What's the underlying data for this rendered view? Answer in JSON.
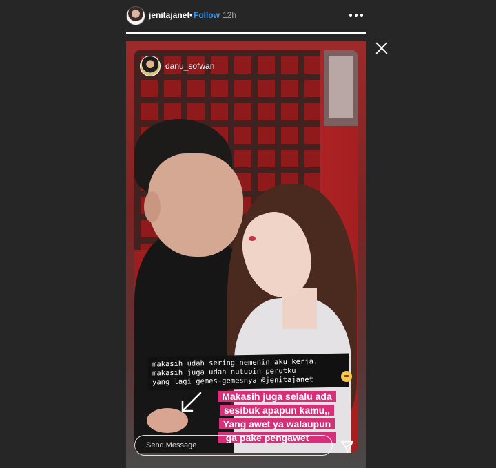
{
  "header": {
    "username": "jenitajanet",
    "separator": "•",
    "follow_label": "Follow",
    "time": "12h"
  },
  "story": {
    "progress_fraction": 1.0,
    "reposted_from": "danu_sofwan",
    "caption_lines": [
      "makasih udah sering nemenin aku kerja.",
      "makasih juga udah nutupin perutku",
      "yang lagi gemes-gemesnya @jenitajanet"
    ],
    "reply_lines": [
      "Makasih juga selalu ada",
      "sesibuk apapun kamu,,",
      "Yang awet ya walaupun",
      "ga pake pengawet"
    ]
  },
  "composer": {
    "placeholder": "Send Message"
  },
  "icons": {
    "more": "more-options-icon",
    "close": "close-icon",
    "send": "send-icon",
    "arrow": "arrow-icon"
  },
  "colors": {
    "follow": "#3897f0",
    "highlight": "#d72f7a",
    "background": "#262626"
  }
}
